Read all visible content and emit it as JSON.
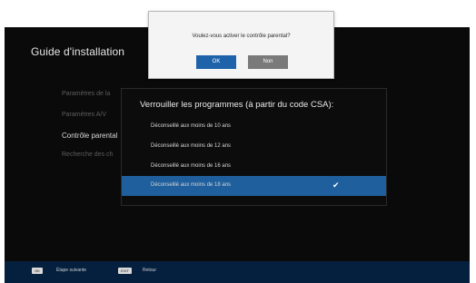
{
  "app_title": "Guide d'installation",
  "menu": {
    "items": [
      "Paramètres de la",
      "Paramètres A/V",
      "Contrôle parental",
      "Recherche des ch"
    ],
    "active_index": 2
  },
  "lock_panel": {
    "title": "Verrouiller les programmes (à partir du code CSA):",
    "options": [
      "Déconseillé aux moins de 10 ans",
      "Déconseillé aux moins de 12 ans",
      "Déconseillé aux moins de 16 ans",
      "Déconseillé aux moins de 18 ans"
    ],
    "selected_index": 3,
    "check_glyph": "✔"
  },
  "dialog": {
    "message": "Voulez-vous activer le contrôle parental?",
    "ok_label": "OK",
    "no_label": "Non"
  },
  "footer": {
    "keys": [
      {
        "key": "OK",
        "label": "Étape suivante"
      },
      {
        "key": "EXIT",
        "label": "Retour"
      }
    ]
  },
  "colors": {
    "screen_bg": "#0a0a0a",
    "highlight": "#1f5f9d",
    "ok_button": "#1e63aa",
    "no_button": "#7a7a7a",
    "footer_bg": "#05203f"
  }
}
